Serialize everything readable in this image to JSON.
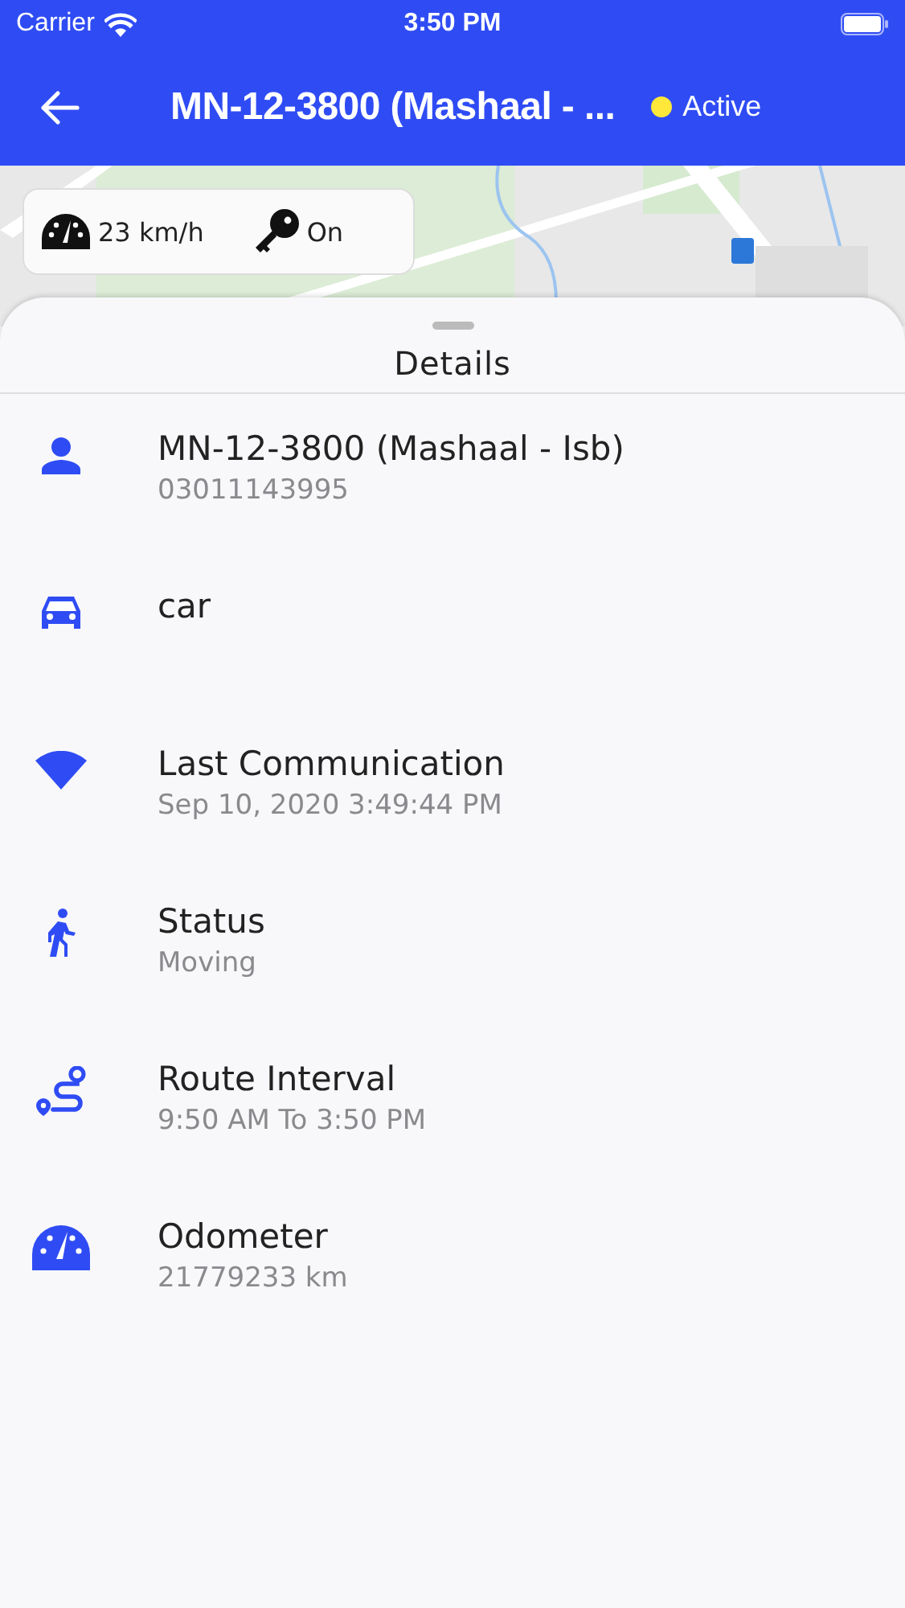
{
  "status_bar": {
    "carrier": "Carrier",
    "time": "3:50 PM"
  },
  "nav_bar": {
    "title": "MN-12-3800 (Mashaal - ...",
    "status": {
      "label": "Active",
      "color": "#ffe83a"
    }
  },
  "map": {
    "kind": "picture",
    "speed": "23 km/h",
    "ignition": "On"
  },
  "sheet": {
    "title": "Details",
    "items": [
      {
        "kind": "person",
        "title": "MN-12-3800 (Mashaal - Isb)",
        "subtitle": "03011143995"
      },
      {
        "kind": "car",
        "title": "car"
      },
      {
        "kind": "signal",
        "title": "Last Communication",
        "subtitle": "Sep 10, 2020 3:49:44 PM"
      },
      {
        "kind": "walker",
        "title": "Status",
        "subtitle": "Moving"
      },
      {
        "kind": "route",
        "title": "Route Interval",
        "subtitle": "9:50 AM To 3:50 PM"
      },
      {
        "kind": "gauge",
        "title": "Odometer",
        "subtitle": "21779233 km"
      }
    ]
  }
}
